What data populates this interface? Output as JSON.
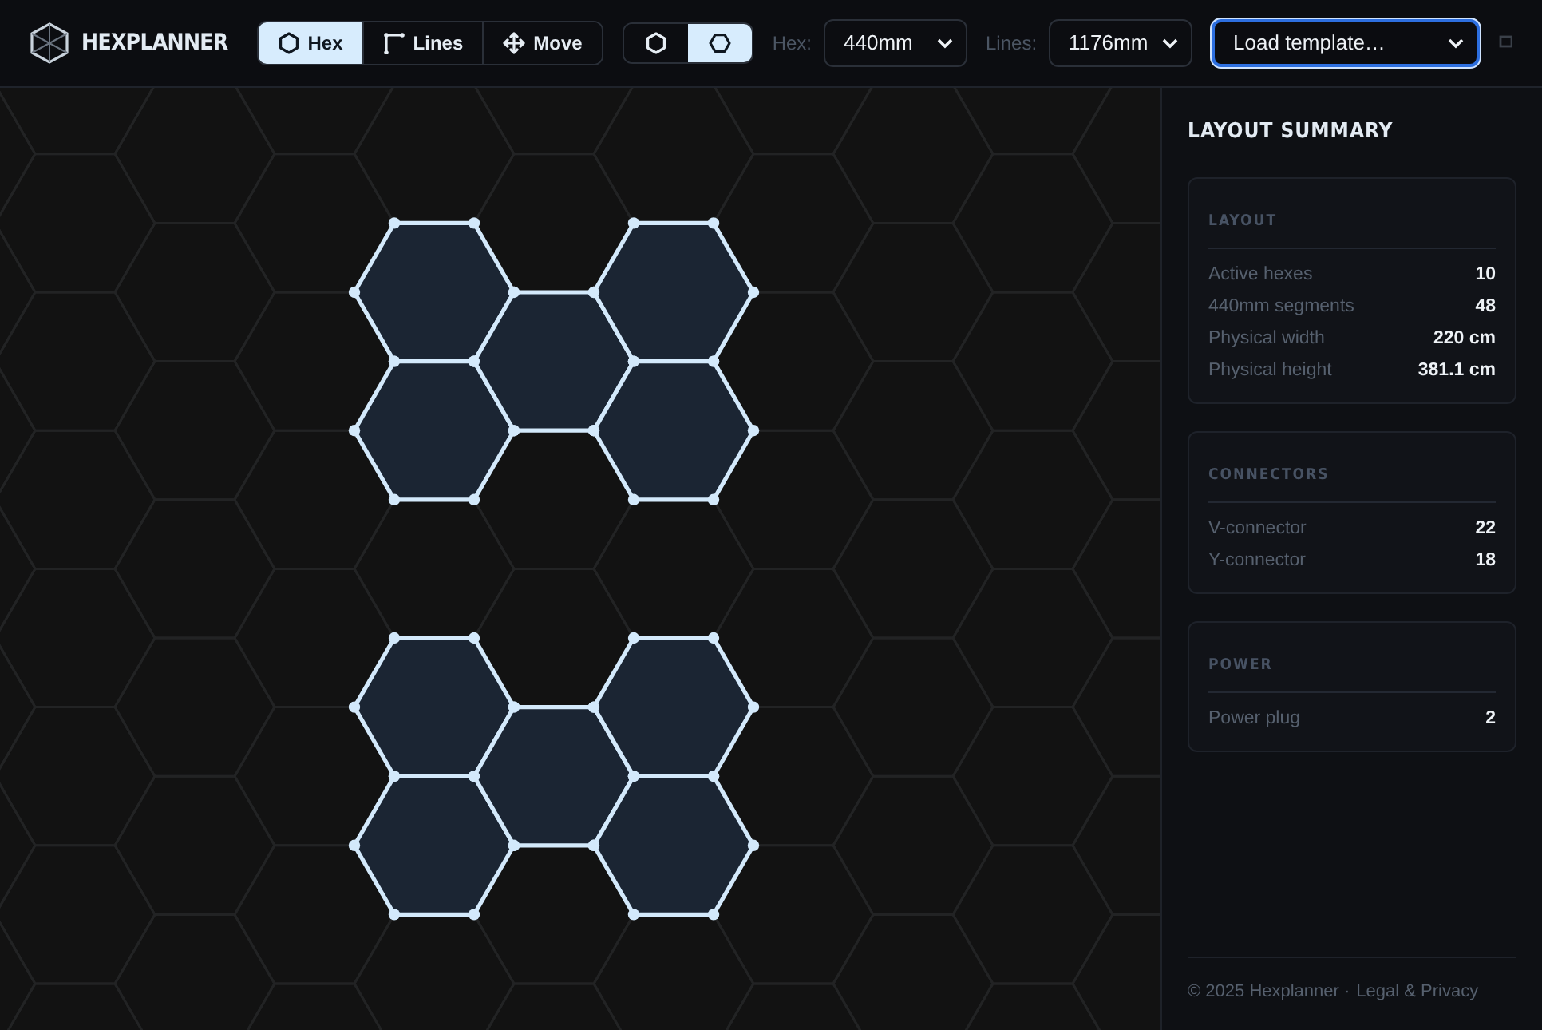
{
  "app": {
    "title": "HEXPLANNER"
  },
  "modes": [
    {
      "label": "Hex",
      "kind": "hex",
      "selected": true
    },
    {
      "label": "Lines",
      "kind": "lines",
      "selected": false
    },
    {
      "label": "Move",
      "kind": "move",
      "selected": false
    }
  ],
  "orientations": [
    {
      "kind": "pointy",
      "selected": false
    },
    {
      "kind": "flat",
      "selected": true
    }
  ],
  "hex_size": {
    "label": "Hex:",
    "value": "440mm"
  },
  "line_length": {
    "label": "Lines:",
    "value": "1176mm"
  },
  "template": {
    "value": "Load template…",
    "focused": true
  },
  "summary": {
    "title": "LAYOUT SUMMARY",
    "sections": [
      {
        "title": "LAYOUT",
        "rows": [
          {
            "label": "Active hexes",
            "value": "10"
          },
          {
            "label": "440mm segments",
            "value": "48"
          },
          {
            "label": "Physical width",
            "value": "220 cm"
          },
          {
            "label": "Physical height",
            "value": "381.1 cm"
          }
        ]
      },
      {
        "title": "CONNECTORS",
        "rows": [
          {
            "label": "V-connector",
            "value": "22"
          },
          {
            "label": "Y-connector",
            "value": "18"
          }
        ]
      },
      {
        "title": "POWER",
        "rows": [
          {
            "label": "Power plug",
            "value": "2"
          }
        ]
      }
    ]
  },
  "footer": {
    "text": "© 2025 Hexplanner ·",
    "link": "Legal & Privacy"
  }
}
